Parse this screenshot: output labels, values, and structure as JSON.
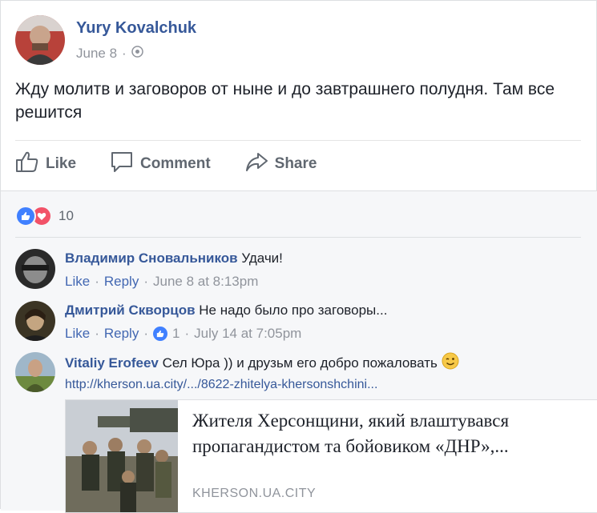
{
  "post": {
    "author": "Yury Kovalchuk",
    "date": "June 8",
    "separator": "·",
    "text": "Жду молитв и заговоров от ныне и до завтрашнего полудня. Там все решится"
  },
  "actions": {
    "like": "Like",
    "comment": "Comment",
    "share": "Share"
  },
  "reactions": {
    "count": "10",
    "types": [
      "like-icon",
      "love-icon"
    ]
  },
  "comments": [
    {
      "author": "Владимир Сновальников",
      "text": "Удачи!",
      "like": "Like",
      "reply": "Reply",
      "time": "June 8 at 8:13pm"
    },
    {
      "author": "Дмитрий Скворцов",
      "text": "Не надо было про заговоры...",
      "like": "Like",
      "reply": "Reply",
      "reaction_count": "1",
      "time": "July 14 at 7:05pm"
    },
    {
      "author": "Vitaliy Erofeev",
      "text": "Сел Юра )) и друзьм его добро пожаловать",
      "link": "http://kherson.ua.city/.../8622-zhitelya-khersonshchini..."
    }
  ],
  "link_preview": {
    "title": "Жителя Херсонщини, який влаштувався пропагандистом та бойовиком «ДНР»,...",
    "domain": "KHERSON.UA.CITY"
  },
  "colors": {
    "name_link": "#365899",
    "meta_gray": "#90949c",
    "like_blue": "#4080ff",
    "love_red": "#f25268"
  }
}
